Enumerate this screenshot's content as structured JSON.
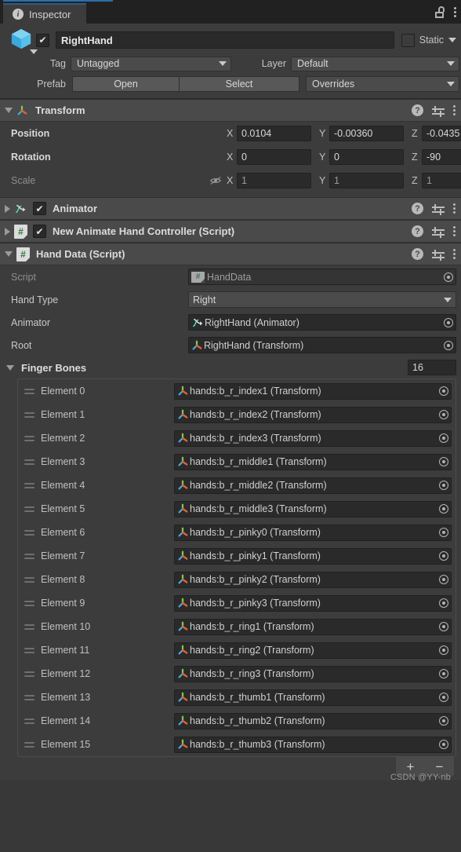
{
  "window": {
    "tab_label": "Inspector",
    "info_icon": "info-icon",
    "lock_icon": "lock-open-icon",
    "menu_icon": "kebab-menu-icon",
    "accent_color": "#2b6ea8"
  },
  "game_object": {
    "icon": "prefab-cube-icon",
    "enabled_checkmark": "✔",
    "name": "RightHand",
    "static_label": "Static",
    "static_checked": false,
    "tag_label": "Tag",
    "tag_value": "Untagged",
    "layer_label": "Layer",
    "layer_value": "Default",
    "prefab_label": "Prefab",
    "open_button": "Open",
    "select_button": "Select",
    "overrides_button": "Overrides"
  },
  "transform": {
    "title": "Transform",
    "icon": "transform-axis-icon",
    "help_icon": "help-icon",
    "preset_icon": "preset-settings-icon",
    "menu_icon": "kebab-menu-icon",
    "rows": [
      {
        "label": "Position",
        "x": "0.0104",
        "y": "-0.00360",
        "z": "-0.0435",
        "dim": false,
        "lock_icon": false
      },
      {
        "label": "Rotation",
        "x": "0",
        "y": "0",
        "z": "-90",
        "dim": false,
        "lock_icon": false
      },
      {
        "label": "Scale",
        "x": "1",
        "y": "1",
        "z": "1",
        "dim": true,
        "lock_icon": true
      }
    ],
    "axis_x": "X",
    "axis_y": "Y",
    "axis_z": "Z"
  },
  "components": [
    {
      "title": "Animator",
      "icon": "animator-icon",
      "expanded": false,
      "has_checkbox": true,
      "checked": true
    },
    {
      "title": "New Animate Hand Controller (Script)",
      "icon": "script-icon",
      "expanded": false,
      "has_checkbox": true,
      "checked": true
    },
    {
      "title": "Hand Data (Script)",
      "icon": "script-icon",
      "expanded": true,
      "has_checkbox": false,
      "checked": false
    }
  ],
  "hand_data": {
    "script_label": "Script",
    "script_value": "HandData",
    "hand_type_label": "Hand Type",
    "hand_type_value": "Right",
    "animator_label": "Animator",
    "animator_value": "RightHand (Animator)",
    "root_label": "Root",
    "root_value": "RightHand (Transform)",
    "finger_bones_label": "Finger Bones",
    "finger_bones_size": "16",
    "add_button": "+",
    "remove_button": "−",
    "elements": [
      {
        "label": "Element 0",
        "value": "hands:b_r_index1 (Transform)"
      },
      {
        "label": "Element 1",
        "value": "hands:b_r_index2 (Transform)"
      },
      {
        "label": "Element 2",
        "value": "hands:b_r_index3 (Transform)"
      },
      {
        "label": "Element 3",
        "value": "hands:b_r_middle1 (Transform)"
      },
      {
        "label": "Element 4",
        "value": "hands:b_r_middle2 (Transform)"
      },
      {
        "label": "Element 5",
        "value": "hands:b_r_middle3 (Transform)"
      },
      {
        "label": "Element 6",
        "value": "hands:b_r_pinky0 (Transform)"
      },
      {
        "label": "Element 7",
        "value": "hands:b_r_pinky1 (Transform)"
      },
      {
        "label": "Element 8",
        "value": "hands:b_r_pinky2 (Transform)"
      },
      {
        "label": "Element 9",
        "value": "hands:b_r_pinky3 (Transform)"
      },
      {
        "label": "Element 10",
        "value": "hands:b_r_ring1 (Transform)"
      },
      {
        "label": "Element 11",
        "value": "hands:b_r_ring2 (Transform)"
      },
      {
        "label": "Element 12",
        "value": "hands:b_r_ring3 (Transform)"
      },
      {
        "label": "Element 13",
        "value": "hands:b_r_thumb1 (Transform)"
      },
      {
        "label": "Element 14",
        "value": "hands:b_r_thumb2 (Transform)"
      },
      {
        "label": "Element 15",
        "value": "hands:b_r_thumb3 (Transform)"
      }
    ]
  },
  "watermark": "CSDN @YY-nb"
}
